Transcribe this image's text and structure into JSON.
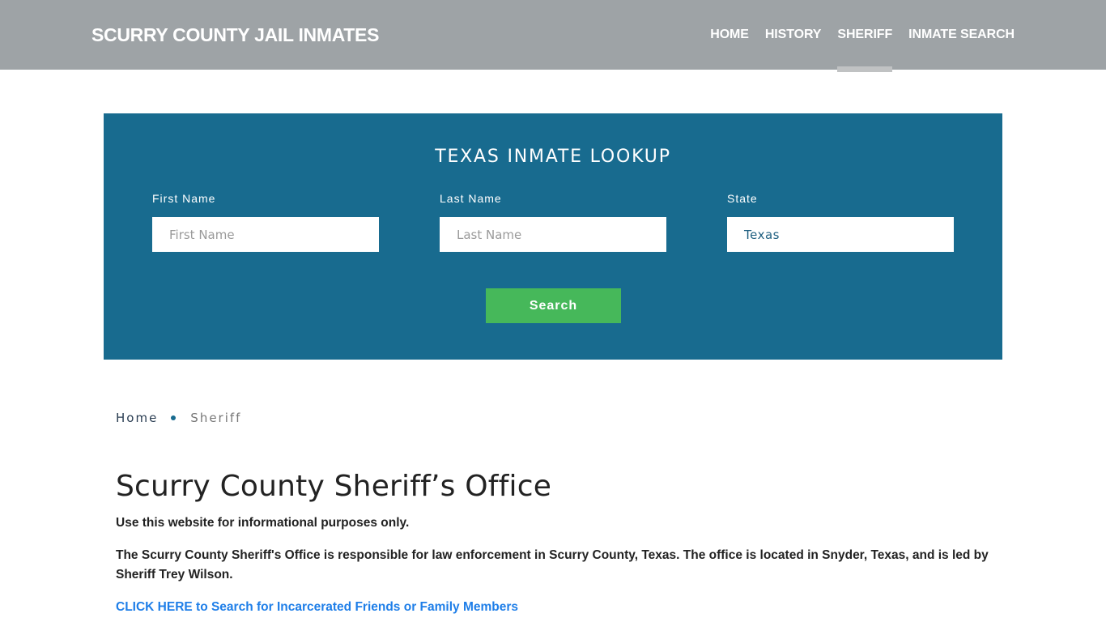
{
  "header": {
    "brand": "SCURRY COUNTY JAIL INMATES",
    "nav": [
      {
        "label": "HOME",
        "active": false
      },
      {
        "label": "HISTORY",
        "active": false
      },
      {
        "label": "SHERIFF",
        "active": true
      },
      {
        "label": "INMATE SEARCH",
        "active": false
      }
    ]
  },
  "lookup": {
    "title": "TEXAS INMATE LOOKUP",
    "first_name": {
      "label": "First Name",
      "placeholder": "First Name",
      "value": ""
    },
    "last_name": {
      "label": "Last Name",
      "placeholder": "Last Name",
      "value": ""
    },
    "state": {
      "label": "State",
      "value": "Texas"
    },
    "search_label": "Search"
  },
  "breadcrumb": {
    "home": "Home",
    "current": "Sheriff"
  },
  "content": {
    "title": "Scurry County Sheriff’s Office",
    "disclaimer": "Use this website for informational purposes only.",
    "description": "The Scurry County Sheriff's Office is responsible for law enforcement in Scurry County, Texas. The office is located in Snyder, Texas, and is led by Sheriff Trey Wilson.",
    "cta_link": "CLICK HERE to Search for Incarcerated Friends or Family Members"
  },
  "colors": {
    "header_bg": "#9ea3a6",
    "lookup_bg": "#186b8f",
    "search_button": "#46b85a",
    "link": "#1e7ee8"
  }
}
